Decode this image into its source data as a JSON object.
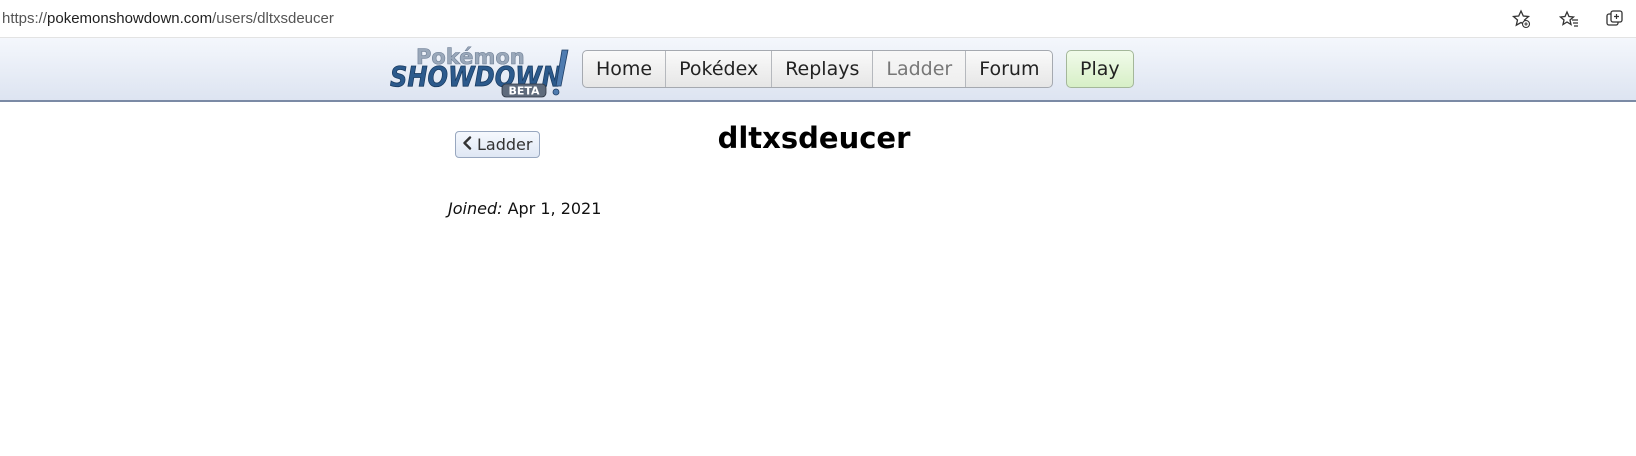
{
  "browser": {
    "url_prefix": "https://",
    "url_host": "pokemonshowdown.com",
    "url_path": "/users/dltxsdeucer",
    "icons": [
      "add-favorite-icon",
      "favorites-icon",
      "collections-icon"
    ]
  },
  "header": {
    "logo": {
      "line1": "Pokémon",
      "line2": "SHOWDOWN",
      "badge": "BETA"
    },
    "nav": [
      {
        "label": "Home"
      },
      {
        "label": "Pokédex"
      },
      {
        "label": "Replays"
      },
      {
        "label": "Ladder",
        "current": true
      },
      {
        "label": "Forum"
      }
    ],
    "play_label": "Play"
  },
  "main": {
    "back_label": "Ladder",
    "username": "dltxsdeucer",
    "joined_label": "Joined:",
    "joined_date": "Apr 1, 2021"
  },
  "colors": {
    "header_bg_top": "#f4f7fc",
    "header_bg_bottom": "#dde4f1",
    "play_bg": "#d7efc7",
    "logo_blue": "#2c5a8c"
  }
}
